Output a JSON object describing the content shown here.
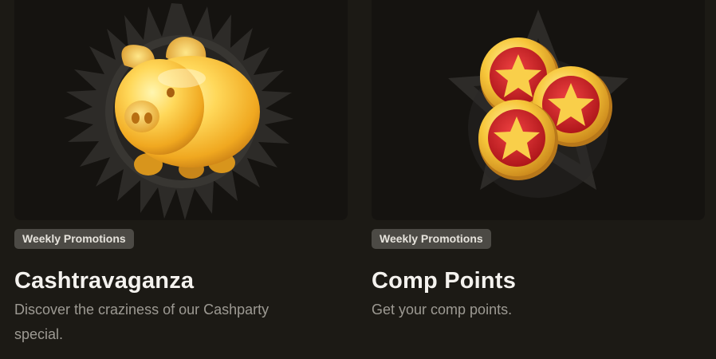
{
  "promotions": [
    {
      "badge": "Weekly Promotions",
      "title": "Cashtravaganza",
      "description": "Discover the craziness of our Cashparty special.",
      "image_icon": "piggy-bank-icon"
    },
    {
      "badge": "Weekly Promotions",
      "title": "Comp Points",
      "description": "Get your comp points.",
      "image_icon": "star-coins-icon"
    }
  ],
  "colors": {
    "background": "#1c1a15",
    "card_image_bg": "#151310",
    "badge_bg": "#4c4a45",
    "title": "#f4f2ee",
    "description": "#9d9a93",
    "gold": "#f2c230",
    "coin_red": "#d11f1f"
  }
}
